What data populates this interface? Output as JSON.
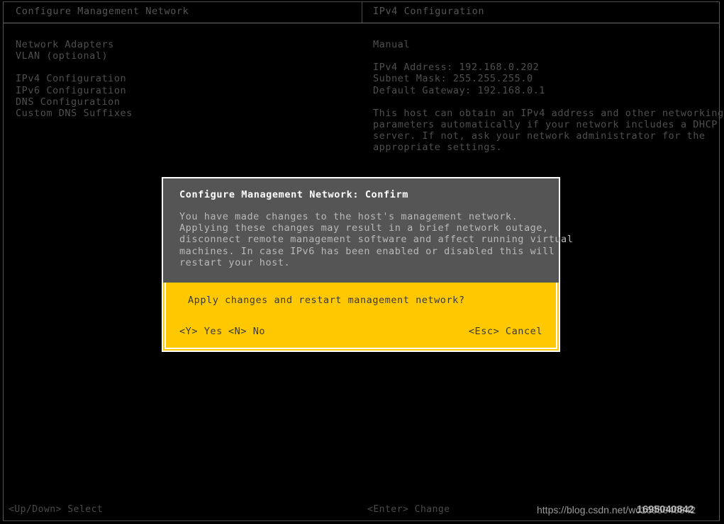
{
  "header": {
    "left_title": "Configure Management Network",
    "right_title": "IPv4 Configuration"
  },
  "menu": {
    "items": [
      "Network Adapters",
      "VLAN (optional)",
      "IPv4 Configuration",
      "IPv6 Configuration",
      "DNS Configuration",
      "Custom DNS Suffixes"
    ]
  },
  "info": {
    "mode": "Manual",
    "ipv4_address": "IPv4 Address: 192.168.0.202",
    "subnet_mask": "Subnet Mask: 255.255.255.0",
    "default_gateway": "Default Gateway: 192.168.0.1",
    "help": [
      "This host can obtain an IPv4 address and other networking",
      "parameters automatically if your network includes a DHCP",
      "server. If not, ask your network administrator for the",
      "appropriate settings."
    ]
  },
  "dialog": {
    "title": "Configure Management Network: Confirm",
    "body": [
      "You have made changes to the host's management network.",
      "Applying these changes may result in a brief network outage,",
      "disconnect remote management software and affect running virtual",
      "machines. In case IPv6 has been enabled or disabled this will",
      "restart your host."
    ],
    "question": "Apply changes and restart management network?",
    "actions": {
      "yes": "<Y> Yes",
      "no": "<N> No",
      "cancel": "<Esc> Cancel"
    },
    "accent_color": "#ffc800",
    "panel_color": "#555555"
  },
  "footer": {
    "select_hint": "<Up/Down> Select",
    "change_hint": "<Enter> Change",
    "watermark": "https://blog.csdn.net/wc1695040842",
    "watermark_overlay": "1695040842"
  }
}
